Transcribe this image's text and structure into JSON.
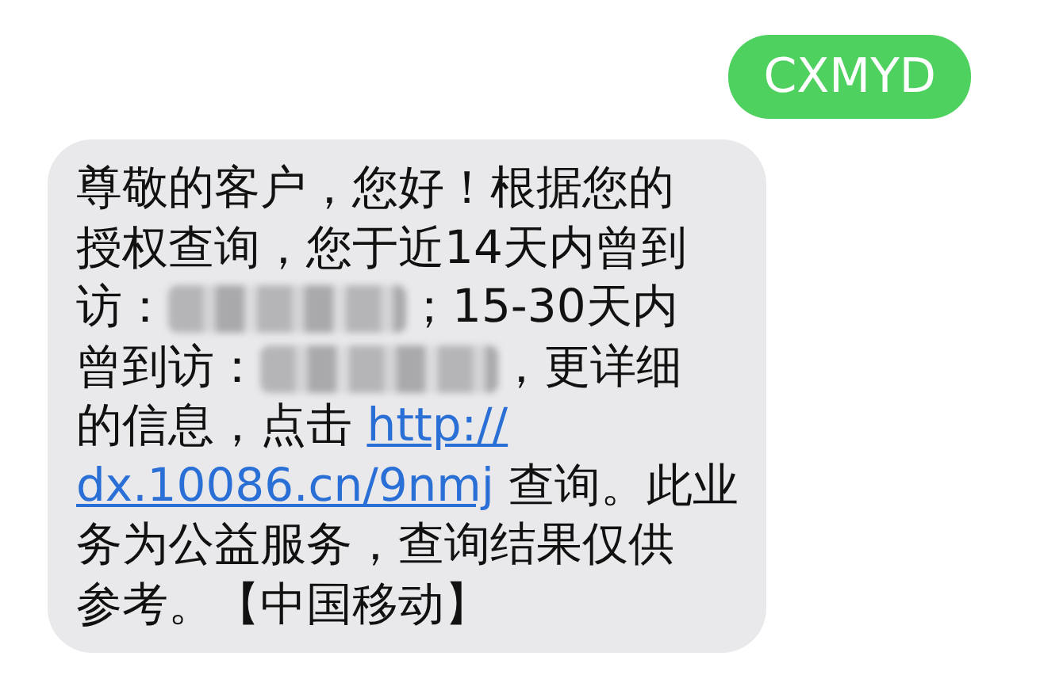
{
  "messages": [
    {
      "kind": "sent",
      "text": "CXMYD"
    },
    {
      "kind": "received",
      "lines": [
        [
          {
            "kind": "text",
            "text": "尊敬的客户，您好！根据您的"
          }
        ],
        [
          {
            "kind": "text",
            "text": "授权查询，您于近14天内曾到"
          }
        ],
        [
          {
            "kind": "text",
            "text": "访："
          },
          {
            "kind": "redacted"
          },
          {
            "kind": "text",
            "text": "；15-30天内"
          }
        ],
        [
          {
            "kind": "text",
            "text": "曾到访："
          },
          {
            "kind": "redacted"
          },
          {
            "kind": "text",
            "text": "，更详细"
          }
        ],
        [
          {
            "kind": "text",
            "text": "的信息，点击 "
          },
          {
            "kind": "link",
            "text": "http://"
          }
        ],
        [
          {
            "kind": "link",
            "text": "dx.10086.cn/9nmj"
          },
          {
            "kind": "text",
            "text": " 查询。此业"
          }
        ],
        [
          {
            "kind": "text",
            "text": "务为公益服务，查询结果仅供"
          }
        ],
        [
          {
            "kind": "text",
            "text": "参考。【中国移动】"
          }
        ]
      ]
    }
  ]
}
